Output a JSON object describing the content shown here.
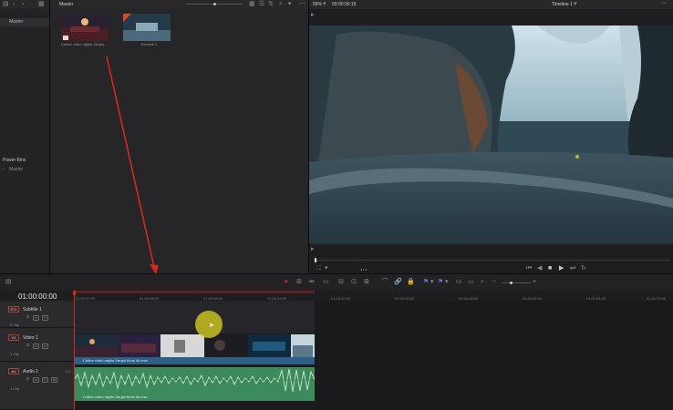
{
  "media_pool": {
    "bin_name": "Master",
    "clips": [
      {
        "name": "Colbor video nights Sergio..."
      },
      {
        "name": "Timeline 1"
      }
    ]
  },
  "bins": {
    "master": "Master",
    "power_bins_title": "Power Bins",
    "power_bins_master": "Master"
  },
  "viewer": {
    "zoom": "56%",
    "timecode": "00:00:00:15",
    "timeline_name": "Timeline 1",
    "jog": "◂ ▪ ▸"
  },
  "timeline": {
    "current_timecode": "01:00:00:00",
    "ruler_marks": [
      "01:00:00:00",
      "01:00:08:00",
      "01:00:16:00",
      "01:00:24:00",
      "01:00:32:00",
      "01:00:40:00",
      "01:00:48:00",
      "01:00:56:00",
      "01:01:04:00",
      "01:01:12:00"
    ],
    "tracks": [
      {
        "badge": "ST1",
        "name": "Subtitle 1",
        "clips": "0 Clip"
      },
      {
        "badge": "V1",
        "name": "Video 1",
        "clips": "1 Clip"
      },
      {
        "badge": "A1",
        "name": "Audio 1",
        "clips": "1 Clip",
        "level": "2.0"
      }
    ],
    "video_clip_label": "Colbor video nights Sergio Moto 4k.mov",
    "audio_clip_label": "Colbor video nights Sergio Moto 4k.mov"
  },
  "colors": {
    "accent_red": "#d42a1e",
    "video_clip_blue": "#2e5f86",
    "audio_clip_green": "#3d8a5c",
    "cursor_highlight": "#c7c11f"
  }
}
